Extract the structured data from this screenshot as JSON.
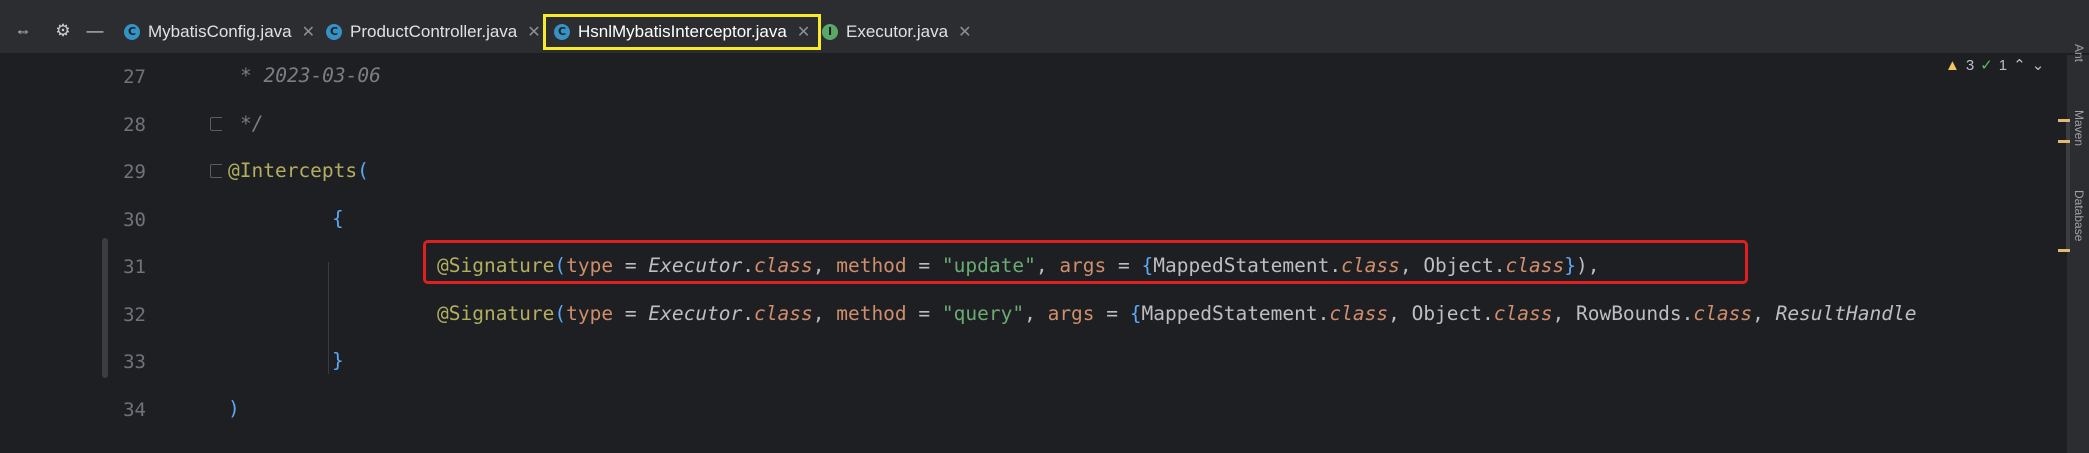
{
  "tabs": [
    {
      "label": "MybatisConfig.java",
      "icon": "C",
      "kind": "class"
    },
    {
      "label": "ProductController.java",
      "icon": "C",
      "kind": "class"
    },
    {
      "label": "HsnlMybatisInterceptor.java",
      "icon": "C",
      "kind": "class",
      "active": true
    },
    {
      "label": "Executor.java",
      "icon": "I",
      "kind": "interface"
    }
  ],
  "inspections": {
    "warnings": "3",
    "checks": "1"
  },
  "right_tool_labels": [
    "Ant",
    "Maven",
    "Database"
  ],
  "lines": [
    {
      "no": "27"
    },
    {
      "no": "28"
    },
    {
      "no": "29"
    },
    {
      "no": "30"
    },
    {
      "no": "31"
    },
    {
      "no": "32"
    },
    {
      "no": "33"
    },
    {
      "no": "34"
    }
  ],
  "code": {
    "l27": "* 2023-03-06",
    "l28": "*/",
    "l29_ann": "@Intercepts",
    "l29_paren": "(",
    "l30": "{",
    "l31": {
      "ann": "@Signature",
      "p1": "(",
      "type_key": "type",
      "eq1": " = ",
      "executor": "Executor",
      "dot1": ".",
      "class1": "class",
      "comma1": ", ",
      "method_key": "method",
      "eq2": " = ",
      "method_val": "\"update\"",
      "comma2": ", ",
      "args_key": "args",
      "eq3": " = ",
      "brace_open": "{",
      "arg1": "MappedStatement",
      "dot2": ".",
      "class2": "class",
      "comma3": ", ",
      "arg2": "Object",
      "dot3": ".",
      "class3": "class",
      "brace_close": "}",
      "end": "),"
    },
    "l32": {
      "ann": "@Signature",
      "p1": "(",
      "type_key": "type",
      "eq1": " = ",
      "executor": "Executor",
      "dot1": ".",
      "class1": "class",
      "comma1": ", ",
      "method_key": "method",
      "eq2": " = ",
      "method_val": "\"query\"",
      "comma2": ", ",
      "args_key": "args",
      "eq3": " = ",
      "brace_open": "{",
      "arg1": "MappedStatement",
      "dot2": ".",
      "class2": "class",
      "comma3": ", ",
      "arg2": "Object",
      "dot3": ".",
      "class3": "class",
      "comma4": ", ",
      "arg3": "RowBounds",
      "dot4": ".",
      "class4": "class",
      "comma5": ", ",
      "arg4": "ResultHandle"
    },
    "l33": "}",
    "l34": ")"
  }
}
